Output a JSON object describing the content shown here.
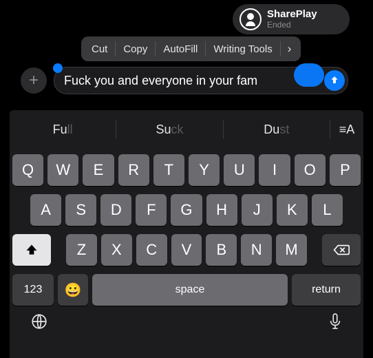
{
  "shareplay": {
    "title": "SharePlay",
    "subtitle": "Ended"
  },
  "context_menu": {
    "items": [
      "Cut",
      "Copy",
      "AutoFill",
      "Writing Tools"
    ],
    "more_glyph": "›"
  },
  "compose": {
    "add_glyph": "+",
    "input_text": "Fuck you and everyone in your fam",
    "send_aria": "Send"
  },
  "suggestions": {
    "s1_main": "Fu",
    "s1_ghost": "ll",
    "s2_main": "Su",
    "s2_ghost": "ck",
    "s3_main": "Du",
    "s3_ghost": "st",
    "format_glyph": "≡A"
  },
  "keys": {
    "row1": [
      "Q",
      "W",
      "E",
      "R",
      "T",
      "Y",
      "U",
      "I",
      "O",
      "P"
    ],
    "row2": [
      "A",
      "S",
      "D",
      "F",
      "G",
      "H",
      "J",
      "K",
      "L"
    ],
    "row3": [
      "Z",
      "X",
      "C",
      "V",
      "B",
      "N",
      "M"
    ],
    "shift_glyph": "⇧",
    "delete_glyph": "⌫",
    "numbers_label": "123",
    "emoji_glyph": "😀",
    "space_label": "space",
    "return_label": "return",
    "globe_glyph": "🌐",
    "mic_glyph": "🎤"
  }
}
